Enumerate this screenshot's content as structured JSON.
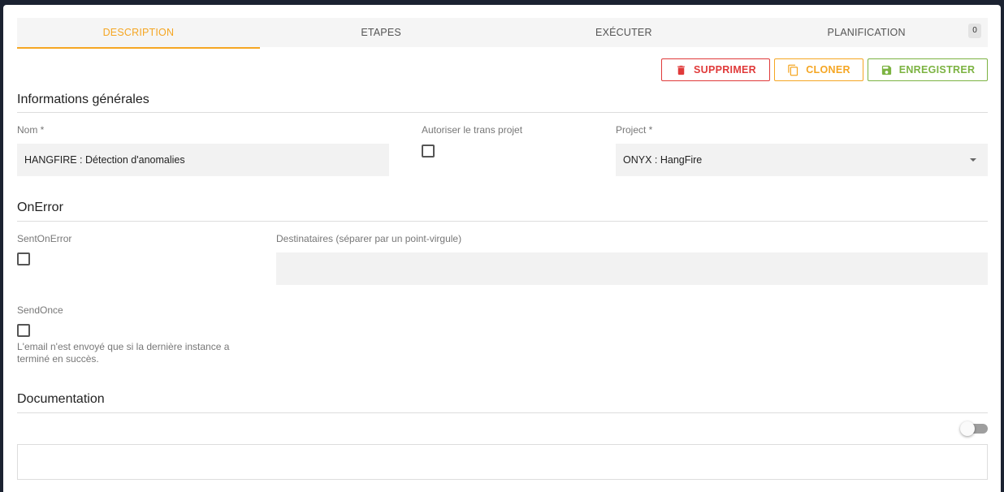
{
  "tabs": [
    {
      "label": "DESCRIPTION",
      "active": true
    },
    {
      "label": "ETAPES"
    },
    {
      "label": "EXÉCUTER"
    },
    {
      "label": "PLANIFICATION",
      "badge": "0"
    }
  ],
  "actions": {
    "delete_label": "SUPPRIMER",
    "clone_label": "CLONER",
    "save_label": "ENREGISTRER",
    "delete_icon": "trash-icon",
    "clone_icon": "copy-icon",
    "save_icon": "floppy-disk-icon"
  },
  "general": {
    "title": "Informations générales",
    "name_label": "Nom *",
    "name_value": "HANGFIRE : Détection d'anomalies",
    "trans_label": "Autoriser le trans projet",
    "trans_checked": false,
    "project_label": "Project *",
    "project_value": "ONYX : HangFire"
  },
  "onerror": {
    "title": "OnError",
    "sent_label": "SentOnError",
    "sent_checked": false,
    "recipients_label": "Destinataires (séparer par un point-virgule)",
    "recipients_value": "",
    "sendonce_label": "SendOnce",
    "sendonce_checked": false,
    "sendonce_help": "L'email n'est envoyé que si la dernière instance a terminé en succès."
  },
  "documentation": {
    "title": "Documentation",
    "toggle_on": false,
    "content": ""
  },
  "colors": {
    "accent": "#f5a623",
    "danger": "#e03a3a",
    "success": "#7cb342",
    "background": "#1b2231"
  }
}
